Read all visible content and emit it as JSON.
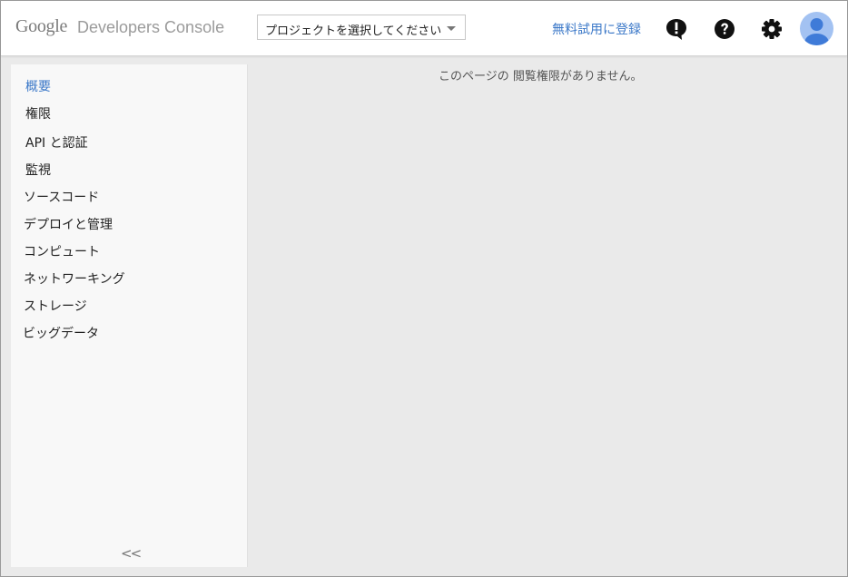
{
  "header": {
    "logo_text": "Google",
    "product_name": "Developers Console",
    "project_select_label": "プロジェクトを選択してください",
    "trial_link": "無料試用に登録",
    "icons": [
      "feedback-icon",
      "help-icon",
      "settings-icon",
      "account-avatar-icon"
    ]
  },
  "sidebar": {
    "items": [
      {
        "label": "概要",
        "active": true
      },
      {
        "label": "権限"
      },
      {
        "label": "API と認証"
      },
      {
        "label": "監視"
      },
      {
        "label": "ソースコード"
      },
      {
        "label": "デプロイと管理"
      },
      {
        "label": "コンピュート"
      },
      {
        "label": "ネットワーキング"
      },
      {
        "label": "ストレージ"
      },
      {
        "label": "ビッグデータ"
      }
    ],
    "collapse_label": "<<"
  },
  "main": {
    "message": "このページの 閲覧権限がありません。"
  },
  "colors": {
    "accent": "#3b78c8",
    "avatar_bg": "#a3c2f2",
    "avatar_fg": "#3f7bd8"
  }
}
